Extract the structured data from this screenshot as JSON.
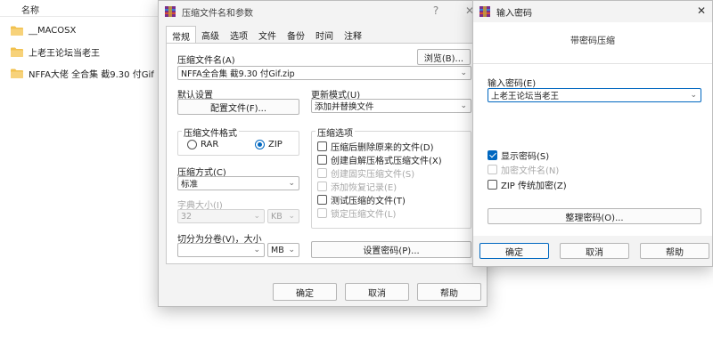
{
  "explorer": {
    "column_header": "名称",
    "items": [
      {
        "name": "__MACOSX"
      },
      {
        "name": "上老王论坛当老王"
      },
      {
        "name": "NFFA大佬 全合集 截9.30 付Gif"
      }
    ]
  },
  "archive_dialog": {
    "title": "压缩文件名和参数",
    "help_symbol": "?",
    "close_symbol": "✕",
    "tabs": [
      "常规",
      "高级",
      "选项",
      "文件",
      "备份",
      "时间",
      "注释"
    ],
    "archive_name_label": "压缩文件名(A)",
    "archive_name_value": "NFFA全合集 截9.30 付Gif.zip",
    "browse_button": "浏览(B)...",
    "default_settings_label": "默认设置",
    "profiles_button": "配置文件(F)...",
    "update_mode_label": "更新模式(U)",
    "update_mode_value": "添加并替换文件",
    "format_group_title": "压缩文件格式",
    "format_options": [
      {
        "label": "RAR",
        "checked": false
      },
      {
        "label": "ZIP",
        "checked": true
      }
    ],
    "options_group_title": "压缩选项",
    "options": [
      {
        "label": "压缩后删除原来的文件(D)",
        "checked": false,
        "enabled": true
      },
      {
        "label": "创建自解压格式压缩文件(X)",
        "checked": false,
        "enabled": true
      },
      {
        "label": "创建固实压缩文件(S)",
        "checked": false,
        "enabled": false
      },
      {
        "label": "添加恢复记录(E)",
        "checked": false,
        "enabled": false
      },
      {
        "label": "测试压缩的文件(T)",
        "checked": false,
        "enabled": true
      },
      {
        "label": "锁定压缩文件(L)",
        "checked": false,
        "enabled": false
      }
    ],
    "method_label": "压缩方式(C)",
    "method_value": "标准",
    "dict_size_label": "字典大小(I)",
    "dict_size_value": "32",
    "dict_size_unit": "KB",
    "split_label": "切分为分卷(V)，大小",
    "split_value": "",
    "split_unit": "MB",
    "set_password_button": "设置密码(P)...",
    "ok_button": "确定",
    "cancel_button": "取消",
    "help_button": "帮助"
  },
  "password_dialog": {
    "title": "输入密码",
    "close_symbol": "✕",
    "subtitle": "带密码压缩",
    "password_label": "输入密码(E)",
    "password_value": "上老王论坛当老王",
    "options": [
      {
        "label": "显示密码(S)",
        "checked": true,
        "enabled": true
      },
      {
        "label": "加密文件名(N)",
        "checked": false,
        "enabled": false
      },
      {
        "label": "ZIP 传统加密(Z)",
        "checked": false,
        "enabled": true
      }
    ],
    "organize_button": "整理密码(O)...",
    "ok_button": "确定",
    "cancel_button": "取消",
    "help_button": "帮助"
  },
  "colors": {
    "accent": "#0067c0",
    "folder": "#f2c14e",
    "dialog_bg": "#f3f3f3"
  }
}
